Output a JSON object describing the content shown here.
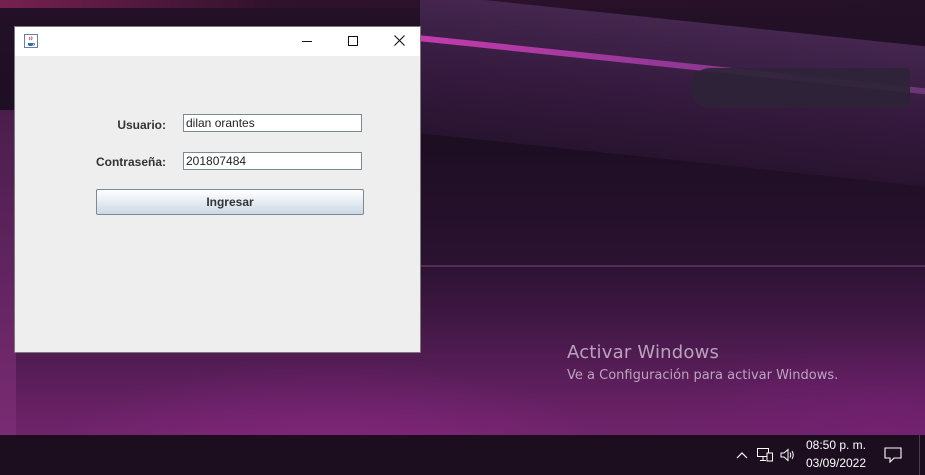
{
  "window": {
    "icon": "java-cup-icon",
    "controls": [
      "minimize-icon",
      "maximize-icon",
      "close-icon"
    ]
  },
  "form": {
    "usuario_label": "Usuario:",
    "usuario_value": "dilan orantes",
    "password_label": "Contraseña:",
    "password_value": "201807484",
    "submit_label": "Ingresar"
  },
  "watermark": {
    "title": "Activar Windows",
    "subtitle": "Ve a Configuración para activar Windows."
  },
  "taskbar": {
    "tray_icons": [
      "chevron-up-icon",
      "network-icon",
      "volume-icon"
    ],
    "time": "08:50 p. m.",
    "date": "03/09/2022",
    "notification_icon": "notification-icon"
  },
  "colors": {
    "window_bg": "#eeeeee",
    "taskbar_bg": "#1c0e1f",
    "accent_purple": "#7b2a75"
  }
}
